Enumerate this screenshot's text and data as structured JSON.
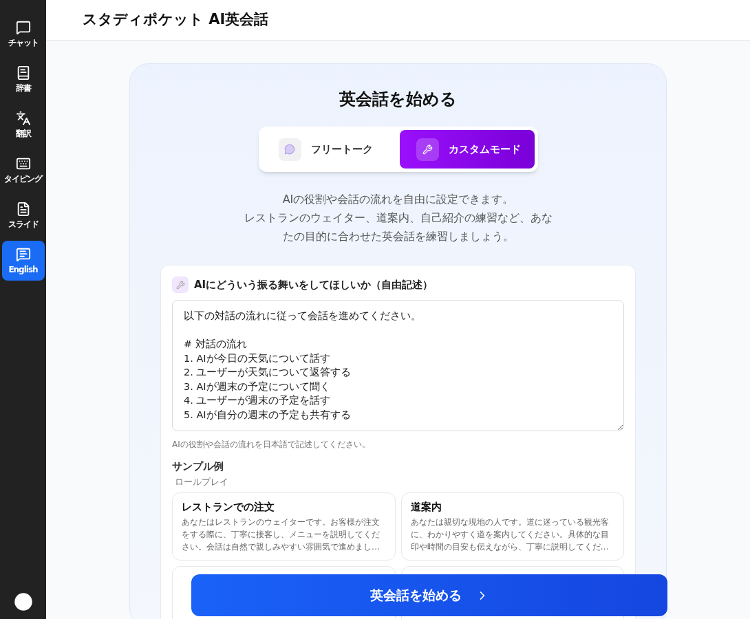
{
  "sidebar": {
    "items": [
      {
        "kind": "chat",
        "label": "チャット",
        "selected": false
      },
      {
        "kind": "dictionary",
        "label": "辞書",
        "selected": false
      },
      {
        "kind": "translate",
        "label": "翻訳",
        "selected": false
      },
      {
        "kind": "typing",
        "label": "タイピング",
        "selected": false
      },
      {
        "kind": "slide",
        "label": "スライド",
        "selected": false
      },
      {
        "kind": "english",
        "label": "English",
        "selected": true
      }
    ]
  },
  "header": {
    "title": "スタディポケット AI英会話"
  },
  "panel": {
    "title": "英会話を始める",
    "modes": [
      {
        "kind": "free",
        "label": "フリートーク",
        "selected": false
      },
      {
        "kind": "custom",
        "label": "カスタムモード",
        "selected": true
      }
    ],
    "description": [
      "AIの役割や会話の流れを自由に設定できます。",
      "レストランのウェイター、道案内、自己紹介の練習など、あな",
      "たの目的に合わせた英会話を練習しましょう。"
    ],
    "form": {
      "label": "AIにどういう振る舞いをしてほしいか（自由記述）",
      "value": "以下の対話の流れに従って会話を進めてください。\n\n# 対話の流れ\n1. AIが今日の天気について話す\n2. ユーザーが天気について返答する\n3. AIが週末の予定について聞く\n4. ユーザーが週末の予定を話す\n5. AIが自分の週末の予定も共有する",
      "hint": "AIの役割や会話の流れを日本語で記述してください。",
      "samples_title": "サンプル例",
      "category": "ロールプレイ",
      "samples": [
        {
          "title": "レストランでの注文",
          "text": "あなたはレストランのウェイターです。お客様が注文をする際に、丁寧に接客し、メニューを説明してください。会話は自然で親しみやすい雰囲気で進めまし…"
        },
        {
          "title": "道案内",
          "text": "あなたは親切な現地の人です。道に迷っている観光客に、わかりやすく道を案内してください。具体的な目印や時間の目安も伝えながら、丁寧に説明してくだ…"
        }
      ]
    },
    "start_button": "英会話を始める"
  }
}
